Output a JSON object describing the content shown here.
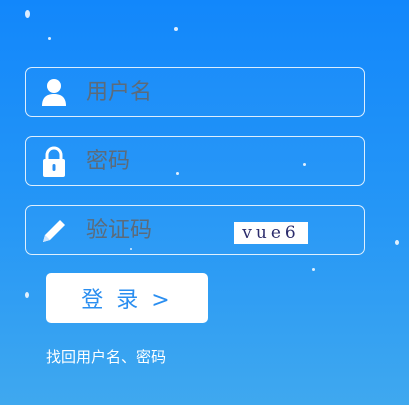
{
  "username": {
    "placeholder": "用户名",
    "icon": "user-icon"
  },
  "password": {
    "placeholder": "密码",
    "icon": "lock-icon"
  },
  "captcha": {
    "placeholder": "验证码",
    "icon": "pencil-icon",
    "image_text": "vue6"
  },
  "login": {
    "label": "登 录 >"
  },
  "recover": {
    "label": "找回用户名、密码"
  },
  "colors": {
    "background": "#1287fb",
    "button_text": "#2a8ef0"
  }
}
